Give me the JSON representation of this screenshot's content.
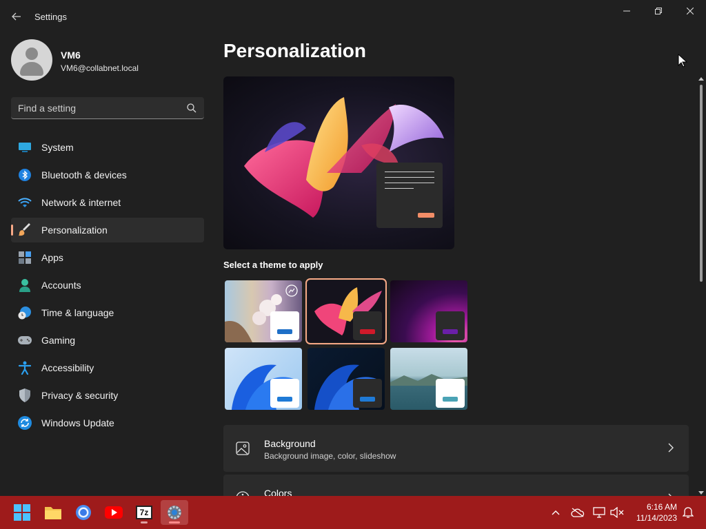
{
  "window": {
    "title": "Settings",
    "controls": {
      "minimize": "minimize",
      "maximize": "restore",
      "close": "close"
    }
  },
  "profile": {
    "name": "VM6",
    "email": "VM6@collabnet.local"
  },
  "search": {
    "placeholder": "Find a setting",
    "value": ""
  },
  "sidebar": {
    "items": [
      {
        "label": "System",
        "icon": "monitor-icon",
        "active": false
      },
      {
        "label": "Bluetooth & devices",
        "icon": "bluetooth-icon",
        "active": false
      },
      {
        "label": "Network & internet",
        "icon": "wifi-icon",
        "active": false
      },
      {
        "label": "Personalization",
        "icon": "paintbrush-icon",
        "active": true
      },
      {
        "label": "Apps",
        "icon": "apps-icon",
        "active": false
      },
      {
        "label": "Accounts",
        "icon": "person-icon",
        "active": false
      },
      {
        "label": "Time & language",
        "icon": "globe-clock-icon",
        "active": false
      },
      {
        "label": "Gaming",
        "icon": "gamepad-icon",
        "active": false
      },
      {
        "label": "Accessibility",
        "icon": "accessibility-icon",
        "active": false
      },
      {
        "label": "Privacy & security",
        "icon": "shield-icon",
        "active": false
      },
      {
        "label": "Windows Update",
        "icon": "refresh-icon",
        "active": false
      }
    ]
  },
  "main": {
    "title": "Personalization",
    "theme_heading": "Select a theme to apply",
    "themes": [
      {
        "id": "theme-flowers",
        "selected": false,
        "accent": "#1f6fc7"
      },
      {
        "id": "theme-glow",
        "selected": true,
        "accent": "#d11a2a"
      },
      {
        "id": "theme-captured-motion",
        "selected": false,
        "accent": "#6a1fa8"
      },
      {
        "id": "theme-windows-light",
        "selected": false,
        "accent": "#1f7ad6"
      },
      {
        "id": "theme-windows-dark",
        "selected": false,
        "accent": "#1f7ad6"
      },
      {
        "id": "theme-sunrise",
        "selected": false,
        "accent": "#4aa3b5"
      }
    ],
    "cards": [
      {
        "title": "Background",
        "subtitle": "Background image, color, slideshow",
        "icon": "image-icon"
      },
      {
        "title": "Colors",
        "subtitle": "",
        "icon": "palette-icon"
      }
    ]
  },
  "taskbar": {
    "apps": [
      {
        "name": "start",
        "icon": "windows-start-icon",
        "active": false
      },
      {
        "name": "file-explorer",
        "icon": "folder-icon",
        "active": false
      },
      {
        "name": "chrome",
        "icon": "chrome-icon",
        "active": false
      },
      {
        "name": "youtube",
        "icon": "youtube-icon",
        "active": false
      },
      {
        "name": "7-zip",
        "icon": "7zip-icon",
        "label": "7z",
        "active": false
      },
      {
        "name": "settings",
        "icon": "settings-gear-icon",
        "active": true
      }
    ],
    "tray": [
      "chevron-up-icon",
      "onedrive-icon",
      "network-icon",
      "volume-muted-icon"
    ],
    "time": "6:16 AM",
    "date": "11/14/2023",
    "notification_icon": "notification-bell-icon"
  },
  "colors": {
    "background": "#202020",
    "accent": "#f7a987",
    "taskbar": "#9e1b1b",
    "card": "#2b2b2b"
  }
}
